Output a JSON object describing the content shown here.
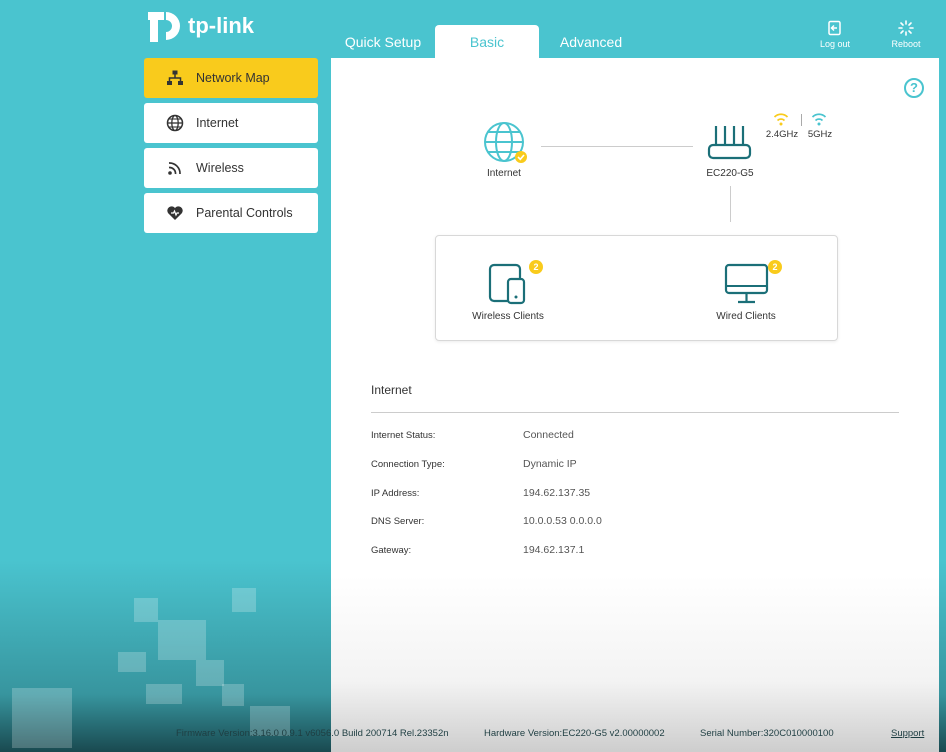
{
  "brand": {
    "logo_text": "tp-link",
    "accent": "#4ac4cf",
    "highlight": "#f9cb1c"
  },
  "tabs": [
    {
      "label": "Quick Setup",
      "active": false
    },
    {
      "label": "Basic",
      "active": true
    },
    {
      "label": "Advanced",
      "active": false
    }
  ],
  "header": {
    "logout_label": "Log out",
    "reboot_label": "Reboot"
  },
  "sidebar": {
    "items": [
      {
        "label": "Network Map",
        "icon": "network-map-icon",
        "active": true
      },
      {
        "label": "Internet",
        "icon": "globe-icon",
        "active": false
      },
      {
        "label": "Wireless",
        "icon": "wireless-icon",
        "active": false
      },
      {
        "label": "Parental Controls",
        "icon": "heart-icon",
        "active": false
      }
    ]
  },
  "network_map": {
    "internet_label": "Internet",
    "router_label": "EC220-G5",
    "band_24": "2.4GHz",
    "band_5": "5GHz",
    "wireless_clients_label": "Wireless Clients",
    "wireless_clients_count": "2",
    "wired_clients_label": "Wired Clients",
    "wired_clients_count": "2"
  },
  "internet_section": {
    "title": "Internet",
    "rows": [
      {
        "label": "Internet Status:",
        "value": "Connected"
      },
      {
        "label": "Connection Type:",
        "value": "Dynamic IP"
      },
      {
        "label": "IP Address:",
        "value": "194.62.137.35"
      },
      {
        "label": "DNS Server:",
        "value": "10.0.0.53 0.0.0.0"
      },
      {
        "label": "Gateway:",
        "value": "194.62.137.1"
      }
    ]
  },
  "footer": {
    "firmware": "Firmware Version:3.16.0 0.9.1 v6056.0 Build 200714 Rel.23352n",
    "hardware": "Hardware Version:EC220-G5 v2.00000002",
    "serial": "Serial Number:320C010000100",
    "support": "Support"
  }
}
